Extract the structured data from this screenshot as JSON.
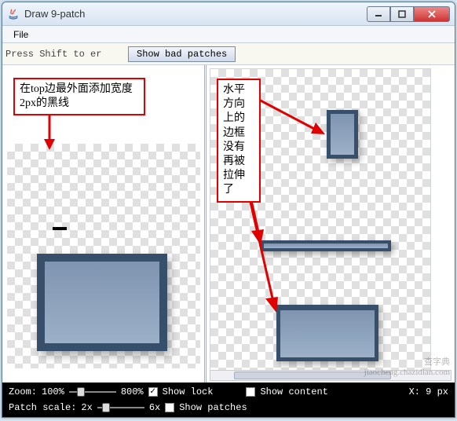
{
  "window": {
    "title": "Draw 9-patch"
  },
  "menu": {
    "file": "File"
  },
  "tools": {
    "hint": "Press Shift to er",
    "show_bad_patches": "Show bad patches"
  },
  "annotations": {
    "left": "在top边最外面添加宽度2px的黑线",
    "right": "水平方向上的边框没有再被拉伸了"
  },
  "bottom": {
    "zoom_label": "Zoom:",
    "zoom_min": "100%",
    "zoom_max": "800%",
    "show_lock": "Show lock",
    "show_content": "Show content",
    "patch_scale_label": "Patch scale:",
    "scale_min": "2x",
    "scale_max": "6x",
    "show_patches": "Show patches",
    "coord": "X: 9 px"
  },
  "checkboxes": {
    "show_lock": true,
    "show_content": false,
    "show_patches": false
  },
  "watermark": {
    "line1": "查字典",
    "line2": "jiaocheng.chazidian.com"
  }
}
